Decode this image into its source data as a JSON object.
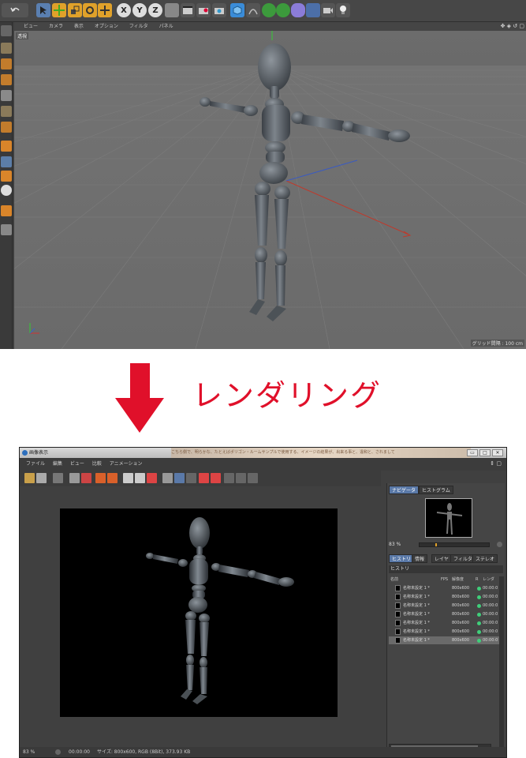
{
  "c4d": {
    "toolbar": {
      "axis_x": "X",
      "axis_y": "Y",
      "axis_z": "Z"
    },
    "viewport_menu": [
      "ビュー",
      "カメラ",
      "表示",
      "オプション",
      "フィルタ",
      "パネル"
    ],
    "viewport_label": "透視",
    "grid_info": "グリッド間隔 : 100 cm"
  },
  "arrow_label": "レンダリング",
  "render_window": {
    "title": "画像表示",
    "blurred_text": "こちら側で、明らかな、たとえばポリゴン・ルームサンプルで使用する、イメージの結果が、出来る事と、違和と、されまして",
    "window_buttons": [
      "▭",
      "□",
      "✕"
    ],
    "menu": [
      "ファイル",
      "編集",
      "ビュー",
      "比較",
      "アニメーション"
    ],
    "panel_tabs_top": [
      "ナビゲータ",
      "ヒストグラム"
    ],
    "zoom": "83 %",
    "panel_tabs_bottom": [
      "ヒストリ",
      "情報",
      "レイヤ",
      "フィルタ",
      "ステレオ"
    ],
    "history_label": "ヒストリ",
    "history_columns": [
      "名前",
      "FPS",
      "解像度",
      "R",
      "レンダ"
    ],
    "history_rows": [
      {
        "name": "名称未設定 1 *",
        "res": "800x600",
        "time": "00:00:0"
      },
      {
        "name": "名称未設定 1 *",
        "res": "800x600",
        "time": "00:00:0"
      },
      {
        "name": "名称未設定 1 *",
        "res": "800x600",
        "time": "00:00:0"
      },
      {
        "name": "名称未設定 1 *",
        "res": "800x600",
        "time": "00:00:0"
      },
      {
        "name": "名称未設定 1 *",
        "res": "800x600",
        "time": "00:00:0"
      },
      {
        "name": "名称未設定 1 *",
        "res": "800x600",
        "time": "00:00:0"
      },
      {
        "name": "名称未設定 1 *",
        "res": "800x600",
        "time": "00:00:0"
      }
    ],
    "status": {
      "zoom": "83 %",
      "time": "00:00:00",
      "info": "サイズ: 800x600, RGB (8Bit), 373.93 KB"
    }
  }
}
